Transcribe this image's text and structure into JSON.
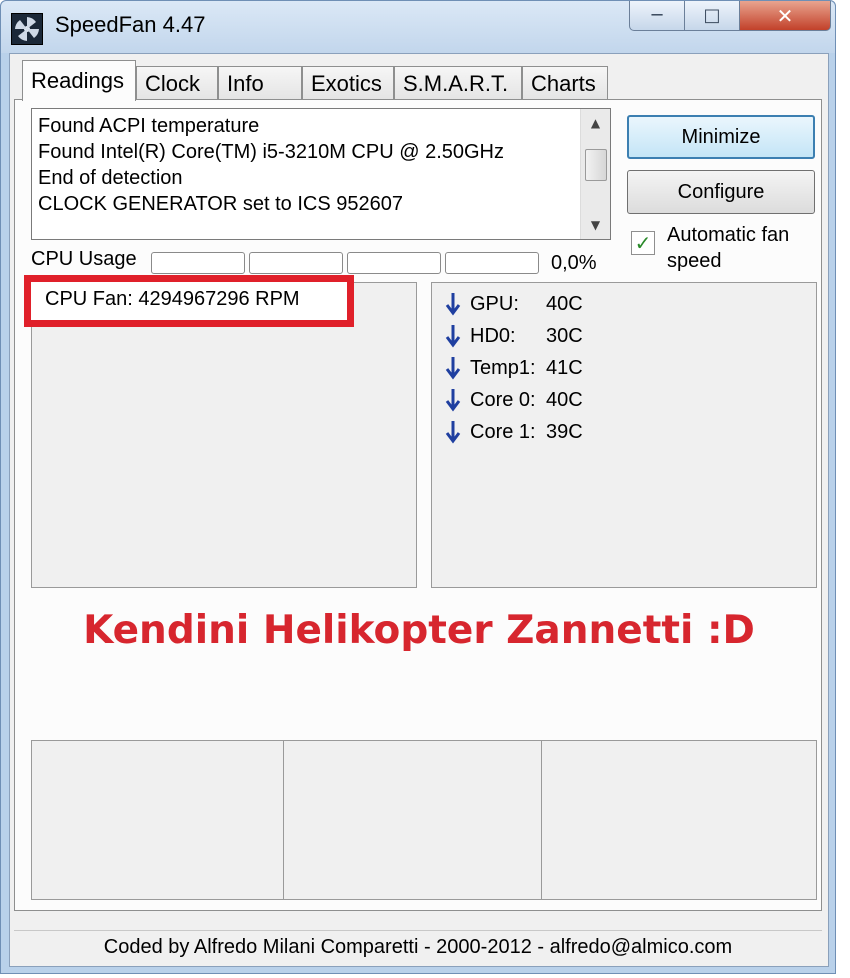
{
  "window": {
    "title": "SpeedFan 4.47"
  },
  "tabs": [
    {
      "label": "Readings",
      "active": true
    },
    {
      "label": "Clock"
    },
    {
      "label": "Info"
    },
    {
      "label": "Exotics"
    },
    {
      "label": "S.M.A.R.T."
    },
    {
      "label": "Charts"
    }
  ],
  "log": {
    "lines": [
      "Found ACPI temperature",
      "Found Intel(R) Core(TM) i5-3210M CPU @ 2.50GHz",
      "End of detection",
      "CLOCK GENERATOR set to ICS 952607"
    ]
  },
  "buttons": {
    "minimize": "Minimize",
    "configure": "Configure"
  },
  "auto_fan": {
    "label": "Automatic fan speed",
    "checked": true
  },
  "cpu_usage": {
    "label": "CPU Usage",
    "value": "0,0%"
  },
  "fans": [
    {
      "text": "CPU Fan: 4294967296 RPM"
    }
  ],
  "temps": [
    {
      "name": "GPU:",
      "value": "40C",
      "trend": "down"
    },
    {
      "name": "HD0:",
      "value": "30C",
      "trend": "down"
    },
    {
      "name": "Temp1:",
      "value": "41C",
      "trend": "down"
    },
    {
      "name": "Core 0:",
      "value": "40C",
      "trend": "down"
    },
    {
      "name": "Core 1:",
      "value": "39C",
      "trend": "down"
    }
  ],
  "overlay": {
    "text": "Kendini Helikopter Zannetti :D",
    "color": "#d7262e"
  },
  "status": {
    "text": "Coded by Alfredo Milani Comparetti - 2000-2012 - alfredo@almico.com"
  },
  "colors": {
    "highlight": "#e0202a",
    "arrow": "#1f3fa0"
  }
}
